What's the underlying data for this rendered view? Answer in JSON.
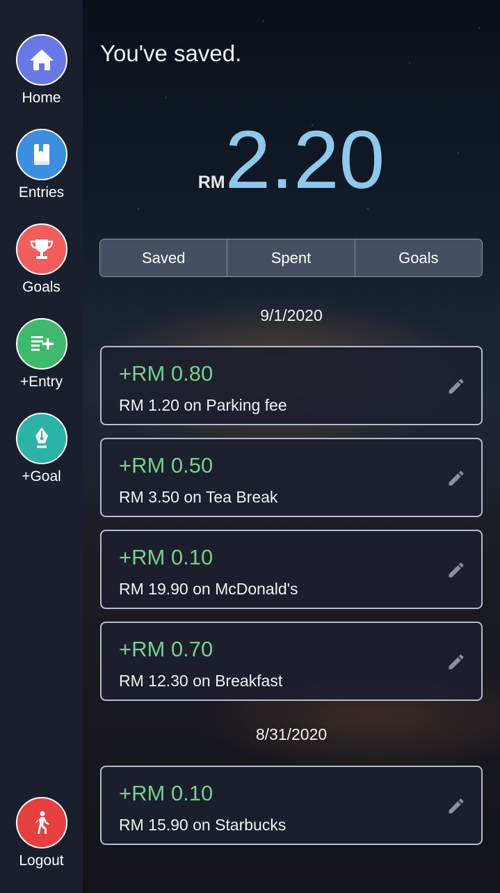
{
  "sidebar": {
    "items": [
      {
        "label": "Home",
        "icon": "home-icon",
        "color": "#6a78e6"
      },
      {
        "label": "Entries",
        "icon": "book-icon",
        "color": "#3c8ee0"
      },
      {
        "label": "Goals",
        "icon": "trophy-icon",
        "color": "#ef5d5d"
      },
      {
        "label": "+Entry",
        "icon": "add-list-icon",
        "color": "#3fba6d"
      },
      {
        "label": "+Goal",
        "icon": "pen-nib-icon",
        "color": "#2ab3a6"
      }
    ],
    "logout": {
      "label": "Logout",
      "icon": "walking-person-icon",
      "color": "#e64040"
    }
  },
  "header": {
    "title": "You've saved.",
    "currency": "RM",
    "amount": "2.20",
    "amount_color": "#8fc8ee"
  },
  "tabs": [
    {
      "label": "Saved"
    },
    {
      "label": "Spent"
    },
    {
      "label": "Goals"
    }
  ],
  "groups": [
    {
      "date": "9/1/2020",
      "entries": [
        {
          "saved": "+RM 0.80",
          "desc": "RM 1.20 on Parking fee"
        },
        {
          "saved": "+RM 0.50",
          "desc": "RM 3.50 on Tea Break"
        },
        {
          "saved": "+RM 0.10",
          "desc": "RM 19.90 on McDonald's"
        },
        {
          "saved": "+RM 0.70",
          "desc": "RM 12.30 on Breakfast"
        }
      ]
    },
    {
      "date": "8/31/2020",
      "entries": [
        {
          "saved": "+RM 0.10",
          "desc": "RM 15.90 on Starbucks"
        }
      ]
    }
  ],
  "colors": {
    "sidebar_bg": "#1a1f2e",
    "saved_green": "#74d08f",
    "card_border": "#b6bdcc"
  }
}
